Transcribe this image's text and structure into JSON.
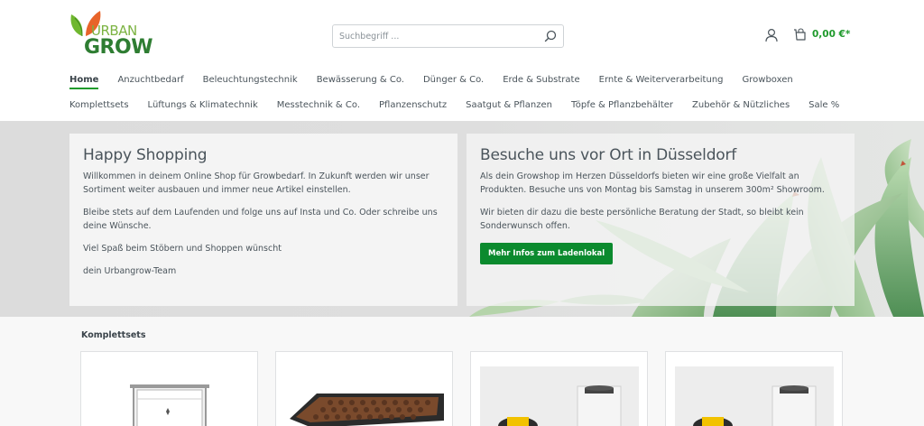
{
  "brand": {
    "logo_top": "URBAN",
    "logo_bottom": "GROW",
    "colors": {
      "primary": "#1f9a2c",
      "button": "#0b8a2e",
      "leaf_orange": "#e8642a"
    }
  },
  "search": {
    "placeholder": "Suchbegriff ..."
  },
  "header": {
    "cart_total": "0,00 €*"
  },
  "nav": {
    "row1": [
      {
        "label": "Home",
        "active": true
      },
      {
        "label": "Anzuchtbedarf"
      },
      {
        "label": "Beleuchtungstechnik"
      },
      {
        "label": "Bewässerung & Co."
      },
      {
        "label": "Dünger & Co."
      },
      {
        "label": "Erde & Substrate"
      },
      {
        "label": "Ernte & Weiterverarbeitung"
      },
      {
        "label": "Growboxen"
      }
    ],
    "row2": [
      {
        "label": "Komplettsets"
      },
      {
        "label": "Lüftungs & Klimatechnik"
      },
      {
        "label": "Messtechnik & Co."
      },
      {
        "label": "Pflanzenschutz"
      },
      {
        "label": "Saatgut & Pflanzen"
      },
      {
        "label": "Töpfe & Pflanzbehälter"
      },
      {
        "label": "Zubehör & Nützliches"
      },
      {
        "label": "Sale %"
      }
    ]
  },
  "hero": {
    "left": {
      "title": "Happy Shopping",
      "paragraphs": [
        "Willkommen in deinem Online Shop für Growbedarf. In Zukunft werden wir unser Sortiment weiter ausbauen und immer neue Artikel einstellen.",
        "Bleibe stets auf dem Laufenden und folge uns auf Insta und Co. Oder schreibe uns deine Wünsche.",
        "Viel Spaß beim Stöbern und Shoppen wünscht",
        "dein Urbangrow-Team"
      ]
    },
    "right": {
      "title": "Besuche uns vor Ort in Düsseldorf",
      "paragraphs": [
        "Als dein Growshop im Herzen Düsseldorfs bieten wir eine große Vielfalt an Produkten. Besuche uns von Montag bis Samstag in unserem 300m² Showroom.",
        "Wir bieten dir dazu die beste persönliche Beratung der Stadt, so bleibt kein Sonderwunsch offen."
      ],
      "button": "Mehr Infos zum Ladenlokal"
    }
  },
  "products_section": {
    "title": "Komplettsets"
  }
}
